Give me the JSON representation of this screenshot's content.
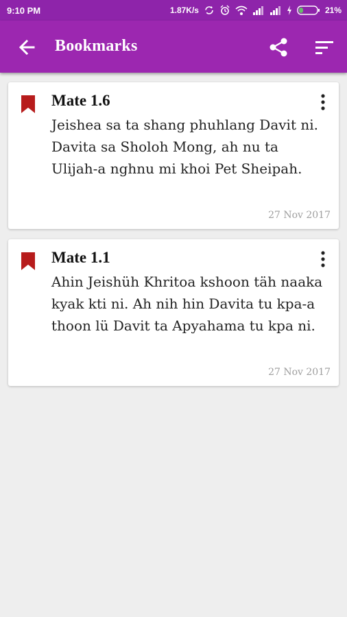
{
  "status_bar": {
    "time": "9:10 PM",
    "net_speed": "1.87K/s",
    "battery_percent": "21%",
    "icons": [
      "sync-icon",
      "alarm-icon",
      "wifi-icon",
      "signal-icon",
      "signal-icon",
      "charging-icon",
      "battery-icon"
    ]
  },
  "app_bar": {
    "title": "Bookmarks",
    "icons": [
      "back-arrow-icon",
      "share-icon",
      "sort-icon"
    ],
    "color": "#9c27b0"
  },
  "bookmarks": [
    {
      "reference": "Mate 1.6",
      "text": "Jeishea sa ta shang phuhlang Davit ni. Davita sa Sholoh Mong, ah nu ta Ulijah-a nghnu mi khoi Pet Sheipah.",
      "date": "27 Nov 2017"
    },
    {
      "reference": "Mate 1.1",
      "text": "Ahin Jeishüh Khritoa kshoon täh naaka kyak kti ni. Ah nih hin Davita tu kpa-a thoon lü Davit ta Apyahama tu kpa ni.",
      "date": "27 Nov 2017"
    }
  ],
  "colors": {
    "bookmark_icon": "#b71c1c",
    "background": "#eeeeee"
  }
}
